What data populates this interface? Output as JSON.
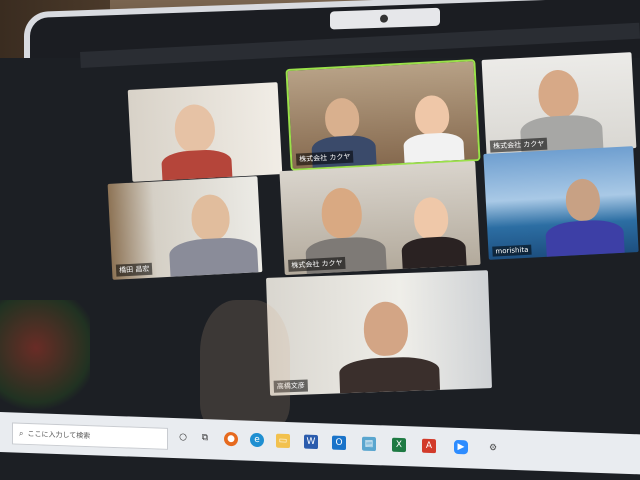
{
  "meeting": {
    "participants": [
      {
        "name": "",
        "active": false
      },
      {
        "name": "株式会社 カクヤ",
        "active": true
      },
      {
        "name": "株式会社 カクヤ",
        "active": false
      },
      {
        "name": "橋田 昌宏",
        "active": false
      },
      {
        "name": "株式会社 カクヤ",
        "active": false
      },
      {
        "name": "morishita",
        "active": false
      },
      {
        "name": "高橋文彦",
        "active": false
      }
    ]
  },
  "taskbar": {
    "search_placeholder": "ここに入力して検索",
    "icons": [
      "task-view-icon",
      "firefox-icon",
      "edge-icon",
      "file-explorer-icon",
      "word-icon",
      "outlook-icon",
      "notepad-icon",
      "excel-icon",
      "acrobat-icon",
      "zoom-icon",
      "settings-icon"
    ]
  },
  "colors": {
    "active_speaker_border": "#9be14a",
    "taskbar": "#e9ecf0"
  }
}
